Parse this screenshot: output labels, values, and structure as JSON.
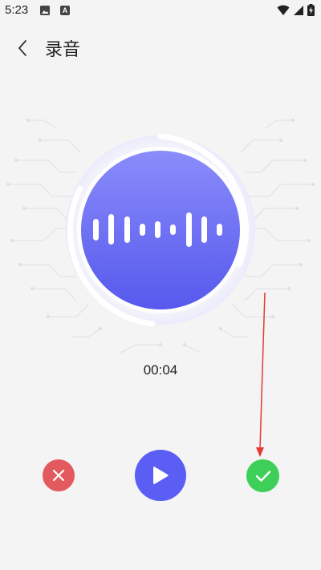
{
  "status_bar": {
    "time": "5:23",
    "a_badge": "A",
    "icons": [
      "image-icon",
      "a-badge-icon",
      "wifi-icon",
      "signal-icon",
      "battery-charging-icon"
    ]
  },
  "header": {
    "back_icon": "chevron-left-icon",
    "title": "录音"
  },
  "recording": {
    "timer": "00:04"
  },
  "controls": {
    "cancel_icon": "close-icon",
    "play_icon": "play-icon",
    "confirm_icon": "check-icon"
  },
  "colors": {
    "background": "#f4f4f4",
    "accent": "#5a5ef5",
    "cancel": "#e35a5e",
    "confirm": "#3dcf57",
    "annotation": "#e53935"
  }
}
